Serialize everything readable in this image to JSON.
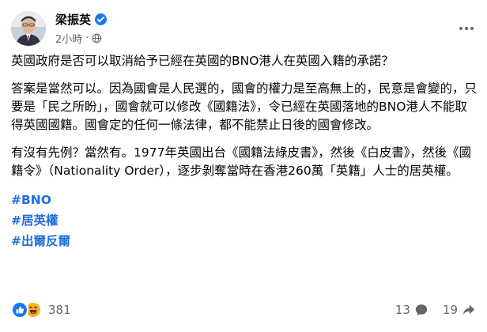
{
  "post": {
    "author": "梁振英",
    "time": "2小時",
    "time_sep": "·",
    "paragraphs": [
      "英國政府是否可以取消給予已經在英國的BNO港人在英國入籍的承諾？",
      "答案是當然可以。因為國會是人民選的，國會的權力是至高無上的，民意是會變的，只要是「民之所盼」，國會就可以修改《國籍法》，令已經在英國落地的BNO港人不能取得英國國籍。國會定的任何一條法律，都不能禁止日後的國會修改。",
      "有沒有先例？當然有。1977年英國出台《國籍法綠皮書》，然後《白皮書》，然後《國籍令》（Nationality Order），逐步剝奪當時在香港260萬「英籍」人士的居英權。"
    ],
    "hashtags": [
      "#BNO",
      "#居英權",
      "#出爾反爾"
    ],
    "reaction_count": "381",
    "comment_count": "13",
    "share_count": "19"
  },
  "icons": {
    "verified": "verified-badge-icon",
    "audience": "globe-icon",
    "more": "more-options-icon",
    "like": "like-reaction-icon",
    "haha": "haha-reaction-icon",
    "comment": "comment-icon",
    "share": "share-icon"
  },
  "colors": {
    "link": "#216fdb",
    "secondary_text": "#65676b",
    "verified": "#1877f2",
    "like": "#1877f2",
    "haha": "#f7b125"
  }
}
